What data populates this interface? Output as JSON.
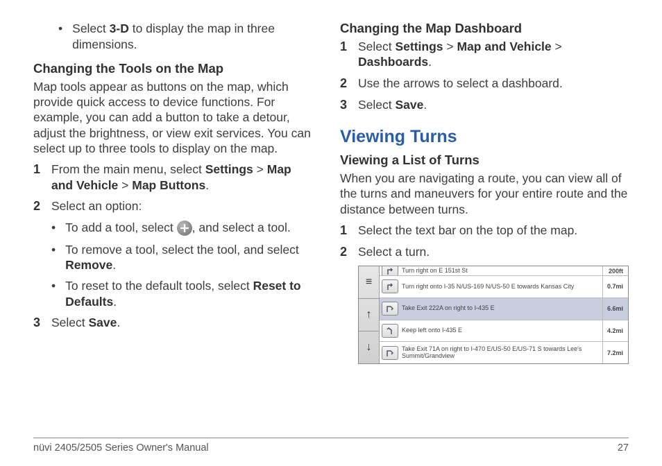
{
  "left": {
    "bullet0": {
      "pre": "Select ",
      "b": "3-D",
      "post": " to display the map in three dimensions."
    },
    "h1": "Changing the Tools on the Map",
    "p1": "Map tools appear as buttons on the map, which provide quick access to device functions. For example, you can add a button to take a detour, adjust the brightness, or view exit services. You can select up to three tools to display on the map.",
    "step1": {
      "n": "1",
      "t1": "From the main menu, select ",
      "b1": "Settings",
      "sep1": " > ",
      "b2": "Map and Vehicle",
      "sep2": " > ",
      "b3": "Map Buttons",
      "post": "."
    },
    "step2": {
      "n": "2",
      "t": "Select an option:"
    },
    "sub": {
      "a": {
        "pre": "To add a tool, select ",
        "post": ", and select a tool."
      },
      "b": {
        "pre": "To remove a tool, select the tool, and select ",
        "bold": "Remove",
        "post": "."
      },
      "c": {
        "pre": "To reset to the default tools, select ",
        "bold": "Reset to Defaults",
        "post": "."
      }
    },
    "step3": {
      "n": "3",
      "pre": "Select ",
      "bold": "Save",
      "post": "."
    }
  },
  "right": {
    "h1": "Changing the Map Dashboard",
    "step1": {
      "n": "1",
      "pre": "Select ",
      "b1": "Settings",
      "s1": " > ",
      "b2": "Map and Vehicle",
      "s2": " > ",
      "b3": "Dashboards",
      "post": "."
    },
    "step2": {
      "n": "2",
      "t": "Use the arrows to select a dashboard."
    },
    "step3": {
      "n": "3",
      "pre": "Select ",
      "bold": "Save",
      "post": "."
    },
    "section": "Viewing Turns",
    "h2": "Viewing a List of Turns",
    "p2": "When you are navigating a route, you can view all of the turns and maneuvers for your entire route and the distance between turns.",
    "step_a": {
      "n": "1",
      "t": "Select the text bar on the top of the map."
    },
    "step_b": {
      "n": "2",
      "t": "Select a turn."
    },
    "shot": {
      "side": {
        "menu": "≡",
        "up": "↑",
        "down": "↓"
      },
      "rows": [
        {
          "label": "Turn right on E 151st St",
          "dist": "200ft"
        },
        {
          "label": "Turn right onto I-35 N/US-169 N/US-50 E towards Kansas City",
          "dist": "0.7mi"
        },
        {
          "label": "Take Exit 222A on right to I-435 E",
          "dist": "6.6mi"
        },
        {
          "label": "Keep left onto I-435 E",
          "dist": "4.2mi"
        },
        {
          "label": "Take Exit 71A on right to I-470 E/US-50 E/US-71 S towards Lee's Summit/Grandview",
          "dist": "7.2mi"
        }
      ]
    }
  },
  "footer": {
    "left": "nüvi 2405/2505 Series Owner's Manual",
    "right": "27"
  }
}
